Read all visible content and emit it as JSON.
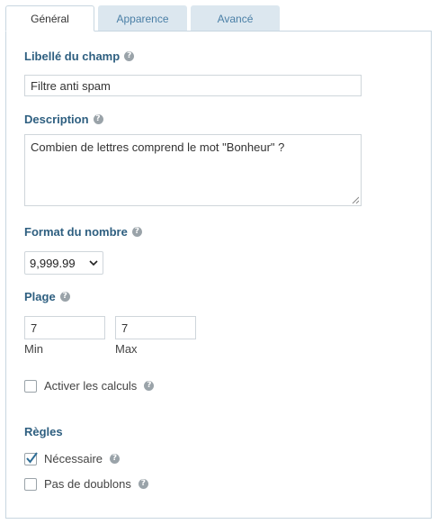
{
  "tabs": [
    {
      "label": "Général",
      "active": true
    },
    {
      "label": "Apparence",
      "active": false
    },
    {
      "label": "Avancé",
      "active": false
    }
  ],
  "field_label": {
    "label": "Libellé du champ",
    "value": "Filtre anti spam"
  },
  "description": {
    "label": "Description",
    "value": "Combien de lettres comprend le mot \"Bonheur\" ?"
  },
  "number_format": {
    "label": "Format du nombre",
    "selected": "9,999.99"
  },
  "range": {
    "label": "Plage",
    "min_value": "7",
    "max_value": "7",
    "min_label": "Min",
    "max_label": "Max"
  },
  "calculations": {
    "label": "Activer les calculs",
    "checked": false
  },
  "rules": {
    "title": "Règles",
    "required": {
      "label": "Nécessaire",
      "checked": true
    },
    "no_duplicates": {
      "label": "Pas de doublons",
      "checked": false
    }
  },
  "colors": {
    "accent": "#2e5f80",
    "tab_inactive_bg": "#dce7ef",
    "tab_inactive_text": "#4a7fa6",
    "border": "#c8d6e0"
  }
}
